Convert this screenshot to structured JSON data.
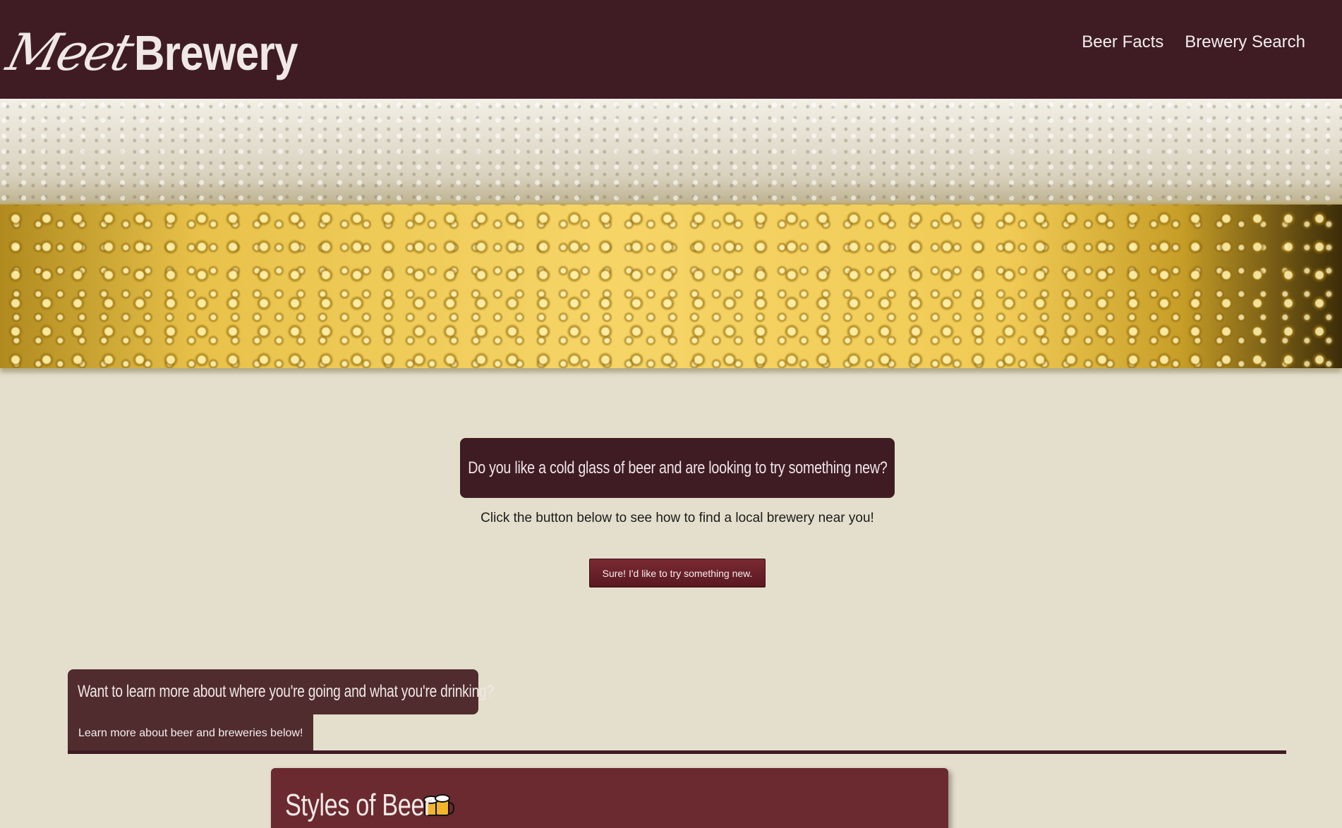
{
  "header": {
    "logo_script": "Meet",
    "logo_bold": "Brewery",
    "nav": [
      {
        "label": "Beer Facts"
      },
      {
        "label": "Brewery Search"
      }
    ],
    "background_color": "#3f1c23"
  },
  "hero": {
    "image": "beer-foam-bubbles-banner"
  },
  "intro": {
    "question": "Do you like a cold glass of beer and are looking to try something new?",
    "text": "Click the button below to see how to find a local brewery near you!",
    "button_label": "Sure! I'd like to try something new."
  },
  "learn": {
    "title": "Want to learn more about where you're going and what you're drinking?",
    "subtitle": "Learn more about beer and breweries below!"
  },
  "card": {
    "title": "Styles of Beer",
    "icon": "beer-mugs-icon"
  },
  "colors": {
    "page_background": "#e4dfcc",
    "accent": "#3f1c23",
    "button": "#6b2029",
    "card": "#6b2a2f"
  }
}
